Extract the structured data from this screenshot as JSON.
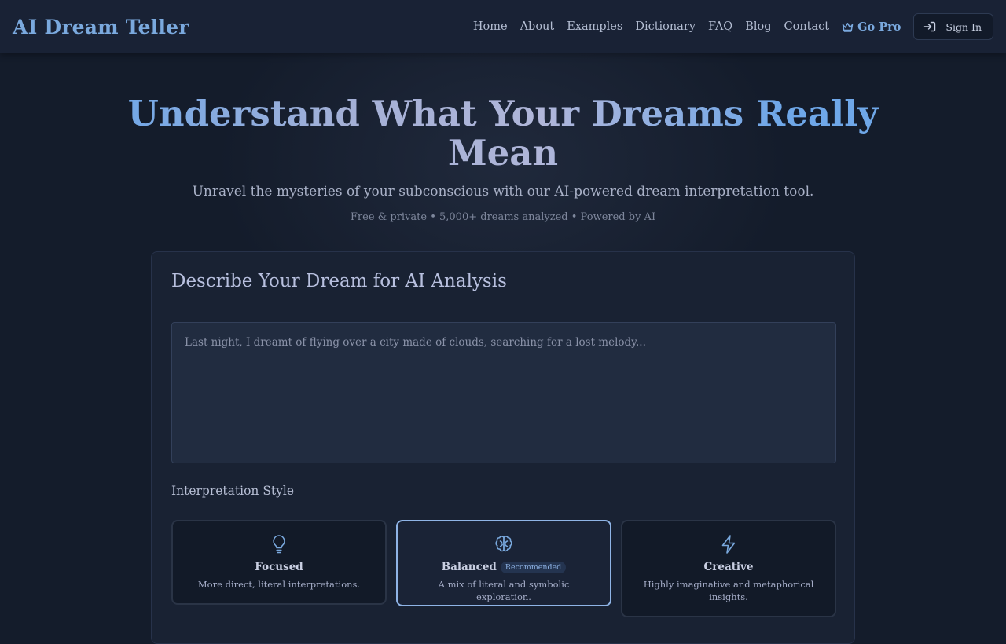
{
  "header": {
    "logo": "AI Dream Teller",
    "nav": [
      "Home",
      "About",
      "Examples",
      "Dictionary",
      "FAQ",
      "Blog",
      "Contact"
    ],
    "go_pro_label": "Go Pro",
    "go_pro_icon": "crown-icon",
    "sign_in_label": "Sign In",
    "sign_in_icon": "sign-in-icon"
  },
  "hero": {
    "title": "Understand What Your Dreams Really Mean",
    "subtitle": "Unravel the mysteries of your subconscious with our AI-powered dream interpretation tool.",
    "meta": "Free & private • 5,000+ dreams analyzed • Powered by AI"
  },
  "form": {
    "title": "Describe Your Dream for AI Analysis",
    "dream_value": "",
    "dream_placeholder": "Last night, I dreamt of flying over a city made of clouds, searching for a lost melody...",
    "style_label": "Interpretation Style",
    "styles": [
      {
        "name": "Focused",
        "description": "More direct, literal interpretations.",
        "icon": "lightbulb-icon",
        "selected": false
      },
      {
        "name": "Balanced",
        "badge": "Recommended",
        "description": "A mix of literal and symbolic exploration.",
        "icon": "brain-icon",
        "selected": true
      },
      {
        "name": "Creative",
        "description": "Highly imaginative and metaphorical insights.",
        "icon": "lightning-icon",
        "selected": false
      }
    ]
  },
  "colors": {
    "background": "#141c2b",
    "header": "#192235",
    "accent": "#7aa9de",
    "card": "#192233",
    "selected_border": "#8fb4e6"
  }
}
